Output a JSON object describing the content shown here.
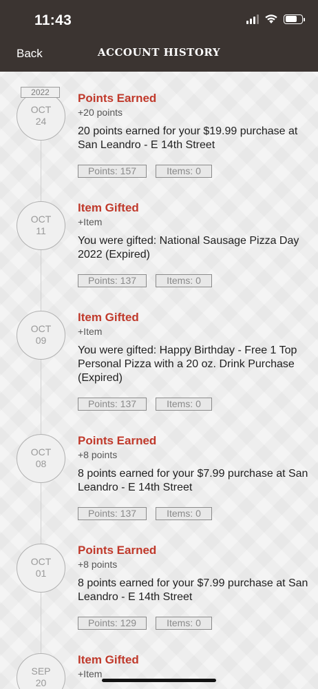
{
  "status_bar": {
    "time": "11:43"
  },
  "header": {
    "back_label": "Back",
    "title": "ACCOUNT HISTORY"
  },
  "year_tag": "2022",
  "entries": [
    {
      "month": "OCT",
      "day": "24",
      "title": "Points Earned",
      "subtitle": "+20 points",
      "description": "20 points earned for your $19.99 purchase at San Leandro - E 14th Street",
      "points": "Points: 157",
      "items": "Items: 0"
    },
    {
      "month": "OCT",
      "day": "11",
      "title": "Item Gifted",
      "subtitle": "+Item",
      "description": "You were gifted: National Sausage Pizza Day 2022 (Expired)",
      "points": "Points: 137",
      "items": "Items: 0"
    },
    {
      "month": "OCT",
      "day": "09",
      "title": "Item Gifted",
      "subtitle": "+Item",
      "description": "You were gifted: Happy Birthday - Free 1 Top Personal Pizza with a 20 oz. Drink Purchase (Expired)",
      "points": "Points: 137",
      "items": "Items: 0"
    },
    {
      "month": "OCT",
      "day": "08",
      "title": "Points Earned",
      "subtitle": "+8 points",
      "description": "8 points earned for your $7.99 purchase at San Leandro - E 14th Street",
      "points": "Points: 137",
      "items": "Items: 0"
    },
    {
      "month": "OCT",
      "day": "01",
      "title": "Points Earned",
      "subtitle": "+8 points",
      "description": "8 points earned for your $7.99 purchase at San Leandro - E 14th Street",
      "points": "Points: 129",
      "items": "Items: 0"
    },
    {
      "month": "SEP",
      "day": "20",
      "title": "Item Gifted",
      "subtitle": "+Item"
    }
  ],
  "colors": {
    "header_bg": "#3b3431",
    "accent_red": "#c0392b"
  },
  "icons": [
    "cellular-signal-icon",
    "wifi-icon",
    "battery-icon"
  ]
}
